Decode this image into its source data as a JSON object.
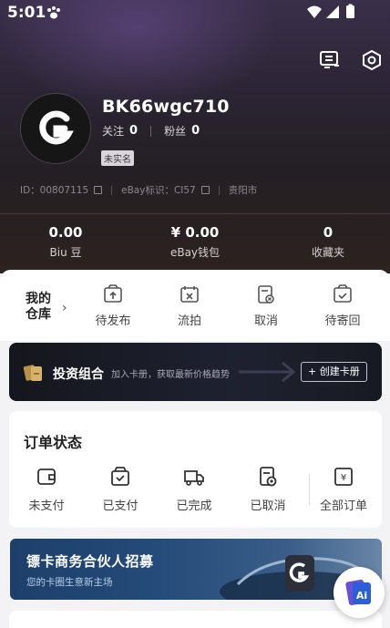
{
  "status_bar": {
    "time": "5:01"
  },
  "profile": {
    "username": "BK66wgc710",
    "following_label": "关注",
    "following_count": "0",
    "followers_label": "粉丝",
    "followers_count": "0",
    "verify_badge": "未实名",
    "id_text": "ID：00807115",
    "ebay_text": "eBay标识：CI57",
    "location": "贵阳市"
  },
  "stats": [
    {
      "value": "0.00",
      "label": "Biu 豆"
    },
    {
      "value": "¥ 0.00",
      "label": "eBay钱包"
    },
    {
      "value": "0",
      "label": "收藏夹"
    }
  ],
  "warehouse": {
    "title": "我的仓库",
    "items": [
      {
        "label": "待发布",
        "icon": "upload-box-icon"
      },
      {
        "label": "流拍",
        "icon": "failed-auction-icon"
      },
      {
        "label": "取消",
        "icon": "cancel-doc-icon"
      },
      {
        "label": "待寄回",
        "icon": "return-box-icon"
      }
    ]
  },
  "portfolio_banner": {
    "title": "投资组合",
    "subtitle": "加入卡册，获取最新价格趋势",
    "button": "+ 创建卡册"
  },
  "orders": {
    "title": "订单状态",
    "items": [
      {
        "label": "未支付",
        "icon": "wallet-icon"
      },
      {
        "label": "已支付",
        "icon": "paid-bag-icon"
      },
      {
        "label": "已完成",
        "icon": "delivery-truck-icon"
      },
      {
        "label": "已取消",
        "icon": "cancelled-doc-icon"
      },
      {
        "label": "全部订单",
        "icon": "all-orders-icon"
      }
    ]
  },
  "partner_banner": {
    "title": "镖卡商务合伙人招募",
    "subtitle": "您的卡圈生意新主场"
  },
  "colors": {
    "hero_bg": "#2b2433",
    "accent_dark": "#1e2130",
    "banner_blue": "#254b7a"
  }
}
